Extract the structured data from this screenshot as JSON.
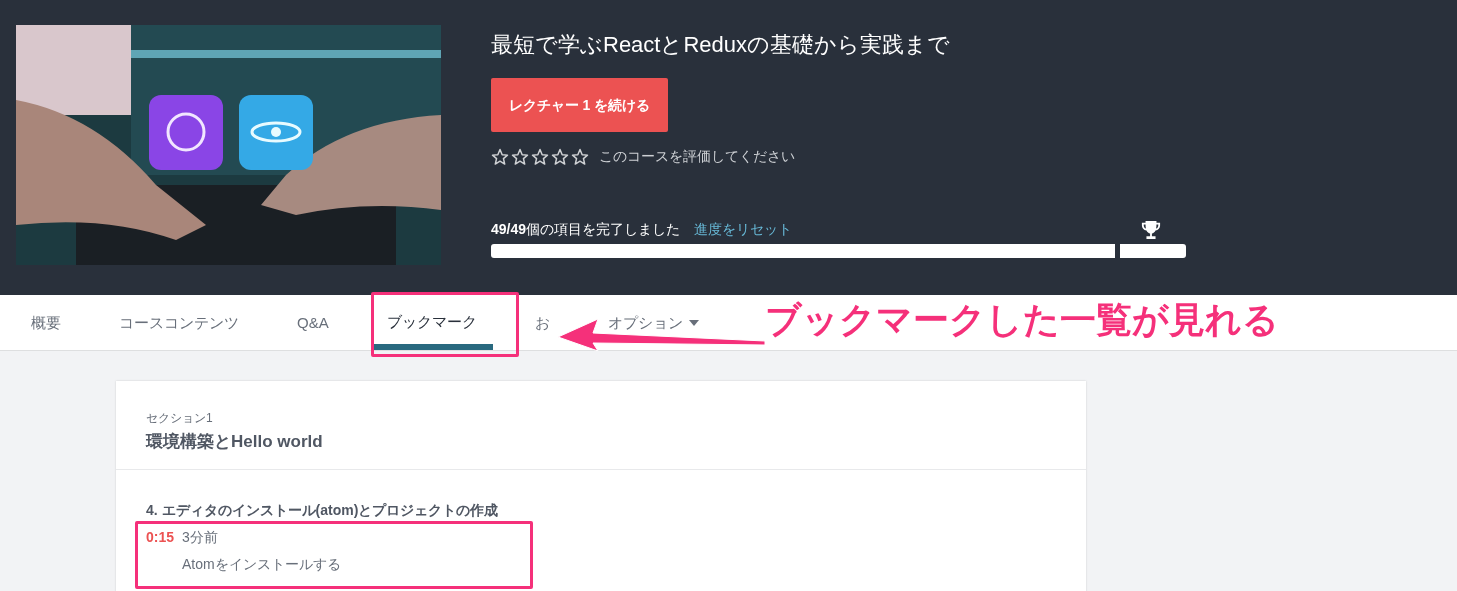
{
  "course": {
    "title": "最短で学ぶReactとReduxの基礎から実践まで",
    "continue_button": "レクチャー 1 を続ける",
    "rating": {
      "stars": 0,
      "prompt": "このコースを評価してください"
    },
    "progress": {
      "count": "49/49",
      "text": "個の項目を完了しました",
      "reset_link": "進度をリセット",
      "level": 1
    }
  },
  "tabs": [
    {
      "label": "概要",
      "selected": false,
      "dropdown": false
    },
    {
      "label": "コースコンテンツ",
      "selected": false,
      "dropdown": false
    },
    {
      "label": "Q&A",
      "selected": false,
      "dropdown": false
    },
    {
      "label": "ブックマーク",
      "selected": true,
      "dropdown": false
    },
    {
      "label": "お",
      "selected": false,
      "dropdown": false
    },
    {
      "label": "オプション",
      "selected": false,
      "dropdown": true
    }
  ],
  "section": {
    "label": "セクション1",
    "title": "環境構築とHello world",
    "lectures": [
      {
        "title": "4. エディタのインストール(atom)とプロジェクトの作成",
        "bookmarks": [
          {
            "time": "0:15",
            "ago": "3分前",
            "note": "Atomをインストールする"
          }
        ]
      }
    ]
  },
  "annotation": {
    "callout": "ブックマークした一覧が見れる"
  }
}
